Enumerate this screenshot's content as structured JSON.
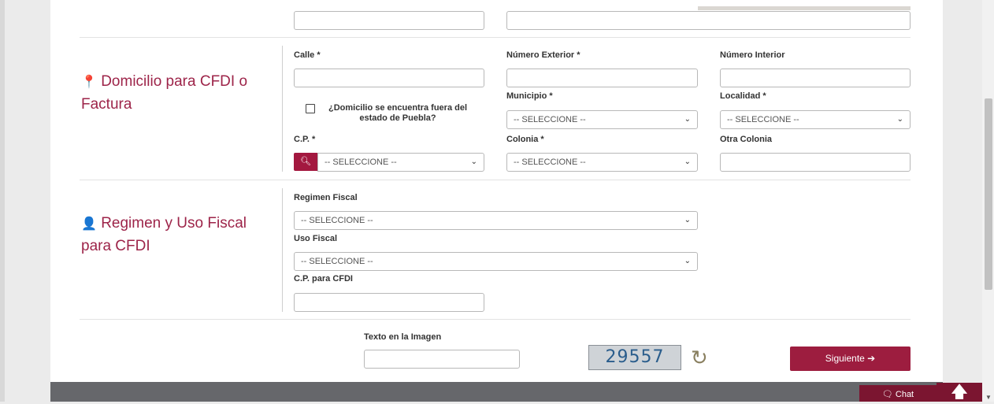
{
  "domicilio": {
    "title": "Domicilio para CFDI o Factura",
    "icon": "map-marker-icon",
    "calle_label": "Calle *",
    "num_ext_label": "Número Exterior *",
    "num_int_label": "Número Interior",
    "fuera_estado_label": "¿Domicilio se encuentra fuera del estado de Puebla?",
    "municipio_label": "Municipio *",
    "municipio_value": "-- SELECCIONE --",
    "localidad_label": "Localidad *",
    "localidad_value": "-- SELECCIONE --",
    "cp_label": "C.P. *",
    "cp_value": "-- SELECCIONE --",
    "colonia_label": "Colonia *",
    "colonia_value": "-- SELECCIONE --",
    "otra_colonia_label": "Otra Colonia"
  },
  "regimen": {
    "title": "Regimen y Uso Fiscal para CFDI",
    "icon": "user-icon",
    "regimen_label": "Regimen Fiscal",
    "regimen_value": "-- SELECCIONE --",
    "uso_label": "Uso Fiscal",
    "uso_value": "-- SELECCIONE --",
    "cp_cfdi_label": "C.P. para CFDI"
  },
  "captcha": {
    "label": "Texto en la Imagen",
    "code": "29557"
  },
  "actions": {
    "next_label": "Siguiente ➔",
    "chat_label": "🗨 Chat",
    "up_label": "🡅"
  },
  "colors": {
    "accent": "#9d2449",
    "footer": "#66676b",
    "button": "#9d1d3f"
  }
}
